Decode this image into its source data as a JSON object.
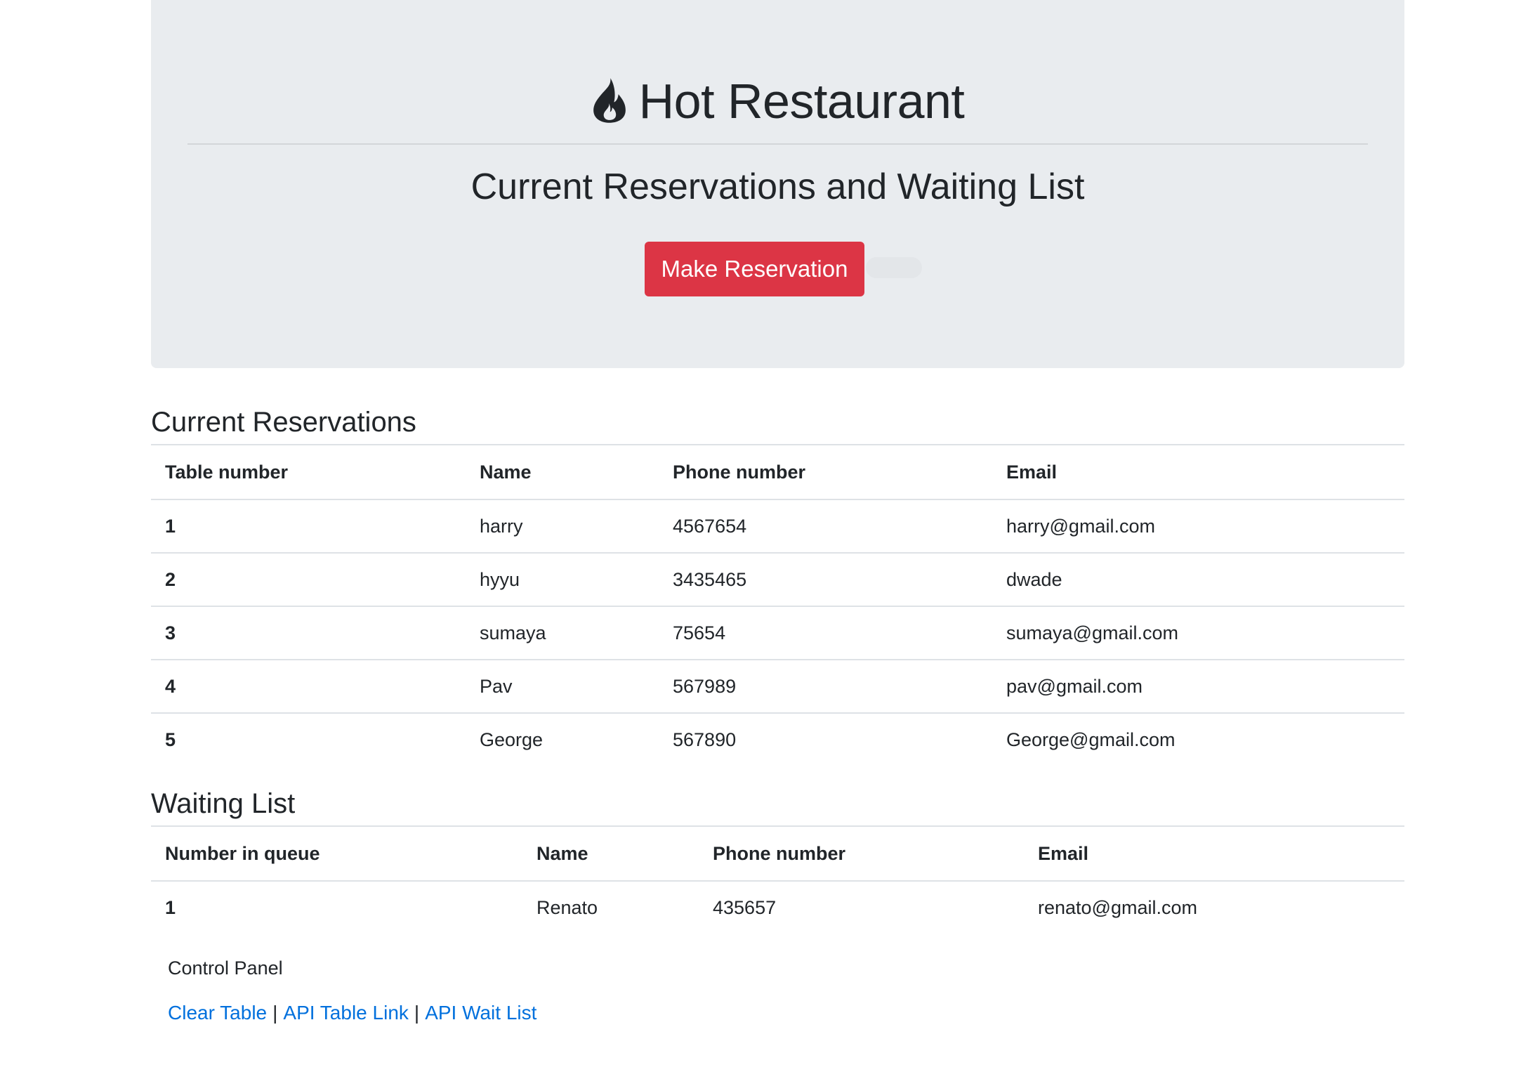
{
  "header": {
    "title": "Hot Restaurant",
    "subtitle": "Current Reservations and Waiting List",
    "reserve_button": "Make Reservation"
  },
  "reservations": {
    "title": "Current Reservations",
    "columns": [
      "Table number",
      "Name",
      "Phone number",
      "Email"
    ],
    "rows": [
      {
        "number": "1",
        "name": "harry",
        "phone": "4567654",
        "email": "harry@gmail.com"
      },
      {
        "number": "2",
        "name": "hyyu",
        "phone": "3435465",
        "email": "dwade"
      },
      {
        "number": "3",
        "name": "sumaya",
        "phone": "75654",
        "email": "sumaya@gmail.com"
      },
      {
        "number": "4",
        "name": "Pav",
        "phone": "567989",
        "email": "pav@gmail.com"
      },
      {
        "number": "5",
        "name": "George",
        "phone": "567890",
        "email": "George@gmail.com"
      }
    ]
  },
  "waitlist": {
    "title": "Waiting List",
    "columns": [
      "Number in queue",
      "Name",
      "Phone number",
      "Email"
    ],
    "rows": [
      {
        "number": "1",
        "name": "Renato",
        "phone": "435657",
        "email": "renato@gmail.com"
      }
    ]
  },
  "control_panel": {
    "label": "Control Panel",
    "links": [
      "Clear Table",
      "API Table Link",
      "API Wait List"
    ],
    "separator": "|"
  },
  "colors": {
    "jumbotron_bg": "#e9ecef",
    "danger": "#dc3545",
    "link": "#0070dd",
    "text": "#212529"
  },
  "icons": {
    "brand": "fire-icon"
  }
}
